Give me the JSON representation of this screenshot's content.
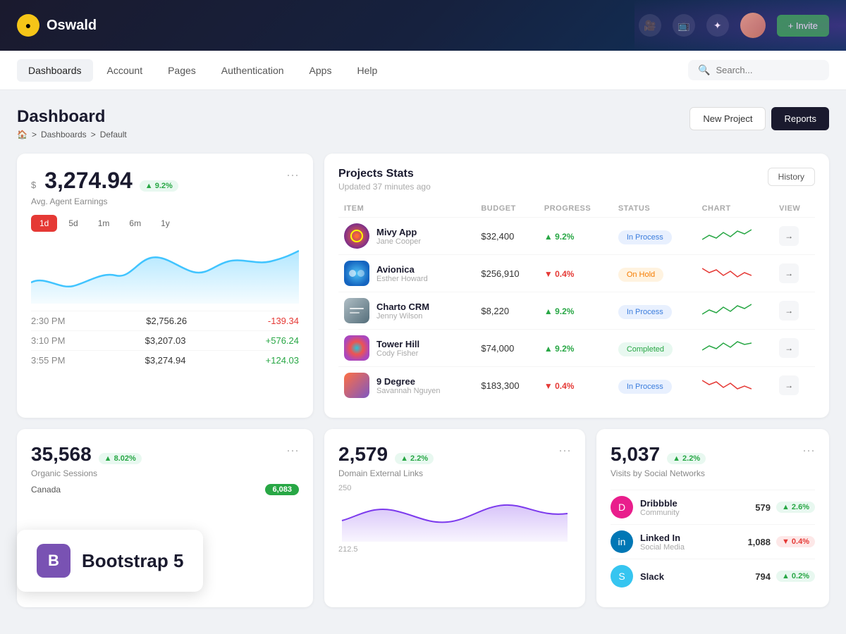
{
  "topbar": {
    "logo_text": "Oswald",
    "invite_label": "+ Invite"
  },
  "navbar": {
    "items": [
      {
        "label": "Dashboards",
        "active": true
      },
      {
        "label": "Account"
      },
      {
        "label": "Pages"
      },
      {
        "label": "Authentication"
      },
      {
        "label": "Apps"
      },
      {
        "label": "Help"
      }
    ],
    "search_placeholder": "Search..."
  },
  "page": {
    "title": "Dashboard",
    "breadcrumb": [
      "🏠",
      "Dashboards",
      "Default"
    ]
  },
  "buttons": {
    "new_project": "New Project",
    "reports": "Reports",
    "history": "History"
  },
  "earnings_card": {
    "currency": "$",
    "amount": "3,274.94",
    "badge": "▲ 9.2%",
    "label": "Avg. Agent Earnings",
    "time_filters": [
      "1d",
      "5d",
      "1m",
      "6m",
      "1y"
    ],
    "active_filter": "1d",
    "rows": [
      {
        "time": "2:30 PM",
        "value": "$2,756.26",
        "change": "-139.34",
        "positive": false
      },
      {
        "time": "3:10 PM",
        "value": "$3,207.03",
        "change": "+576.24",
        "positive": true
      },
      {
        "time": "3:55 PM",
        "value": "$3,274.94",
        "change": "+124.03",
        "positive": true
      }
    ]
  },
  "projects_stats": {
    "title": "Projects Stats",
    "subtitle": "Updated 37 minutes ago",
    "columns": [
      "ITEM",
      "BUDGET",
      "PROGRESS",
      "STATUS",
      "CHART",
      "VIEW"
    ],
    "rows": [
      {
        "name": "Mivy App",
        "person": "Jane Cooper",
        "budget": "$32,400",
        "progress": "▲ 9.2%",
        "progress_pos": true,
        "status": "In Process",
        "status_type": "inprocess"
      },
      {
        "name": "Avionica",
        "person": "Esther Howard",
        "budget": "$256,910",
        "progress": "▼ 0.4%",
        "progress_pos": false,
        "status": "On Hold",
        "status_type": "onhold"
      },
      {
        "name": "Charto CRM",
        "person": "Jenny Wilson",
        "budget": "$8,220",
        "progress": "▲ 9.2%",
        "progress_pos": true,
        "status": "In Process",
        "status_type": "inprocess"
      },
      {
        "name": "Tower Hill",
        "person": "Cody Fisher",
        "budget": "$74,000",
        "progress": "▲ 9.2%",
        "progress_pos": true,
        "status": "Completed",
        "status_type": "completed"
      },
      {
        "name": "9 Degree",
        "person": "Savannah Nguyen",
        "budget": "$183,300",
        "progress": "▼ 0.4%",
        "progress_pos": false,
        "status": "In Process",
        "status_type": "inprocess"
      }
    ]
  },
  "organic": {
    "number": "35,568",
    "badge": "▲ 8.02%",
    "label": "Organic Sessions",
    "country": "Canada",
    "country_val": "6,083"
  },
  "domain": {
    "number": "2,579",
    "badge": "▲ 2.2%",
    "label": "Domain External Links",
    "chart_labels": [
      "250",
      "212.5"
    ]
  },
  "social": {
    "number": "5,037",
    "badge": "▲ 2.2%",
    "label": "Visits by Social Networks",
    "items": [
      {
        "name": "Dribbble",
        "type": "Community",
        "count": "579",
        "badge": "▲ 2.6%",
        "pos": true,
        "icon": "D",
        "icon_class": "social-icon-pink"
      },
      {
        "name": "Linked In",
        "type": "Social Media",
        "count": "1,088",
        "badge": "▼ 0.4%",
        "pos": false,
        "icon": "in",
        "icon_class": "social-icon-blue"
      },
      {
        "name": "Slack",
        "type": "",
        "count": "794",
        "badge": "▲ 0.2%",
        "pos": true,
        "icon": "S",
        "icon_class": "social-icon-cyan"
      }
    ]
  },
  "bootstrap": {
    "label": "Bootstrap 5",
    "icon": "B"
  }
}
